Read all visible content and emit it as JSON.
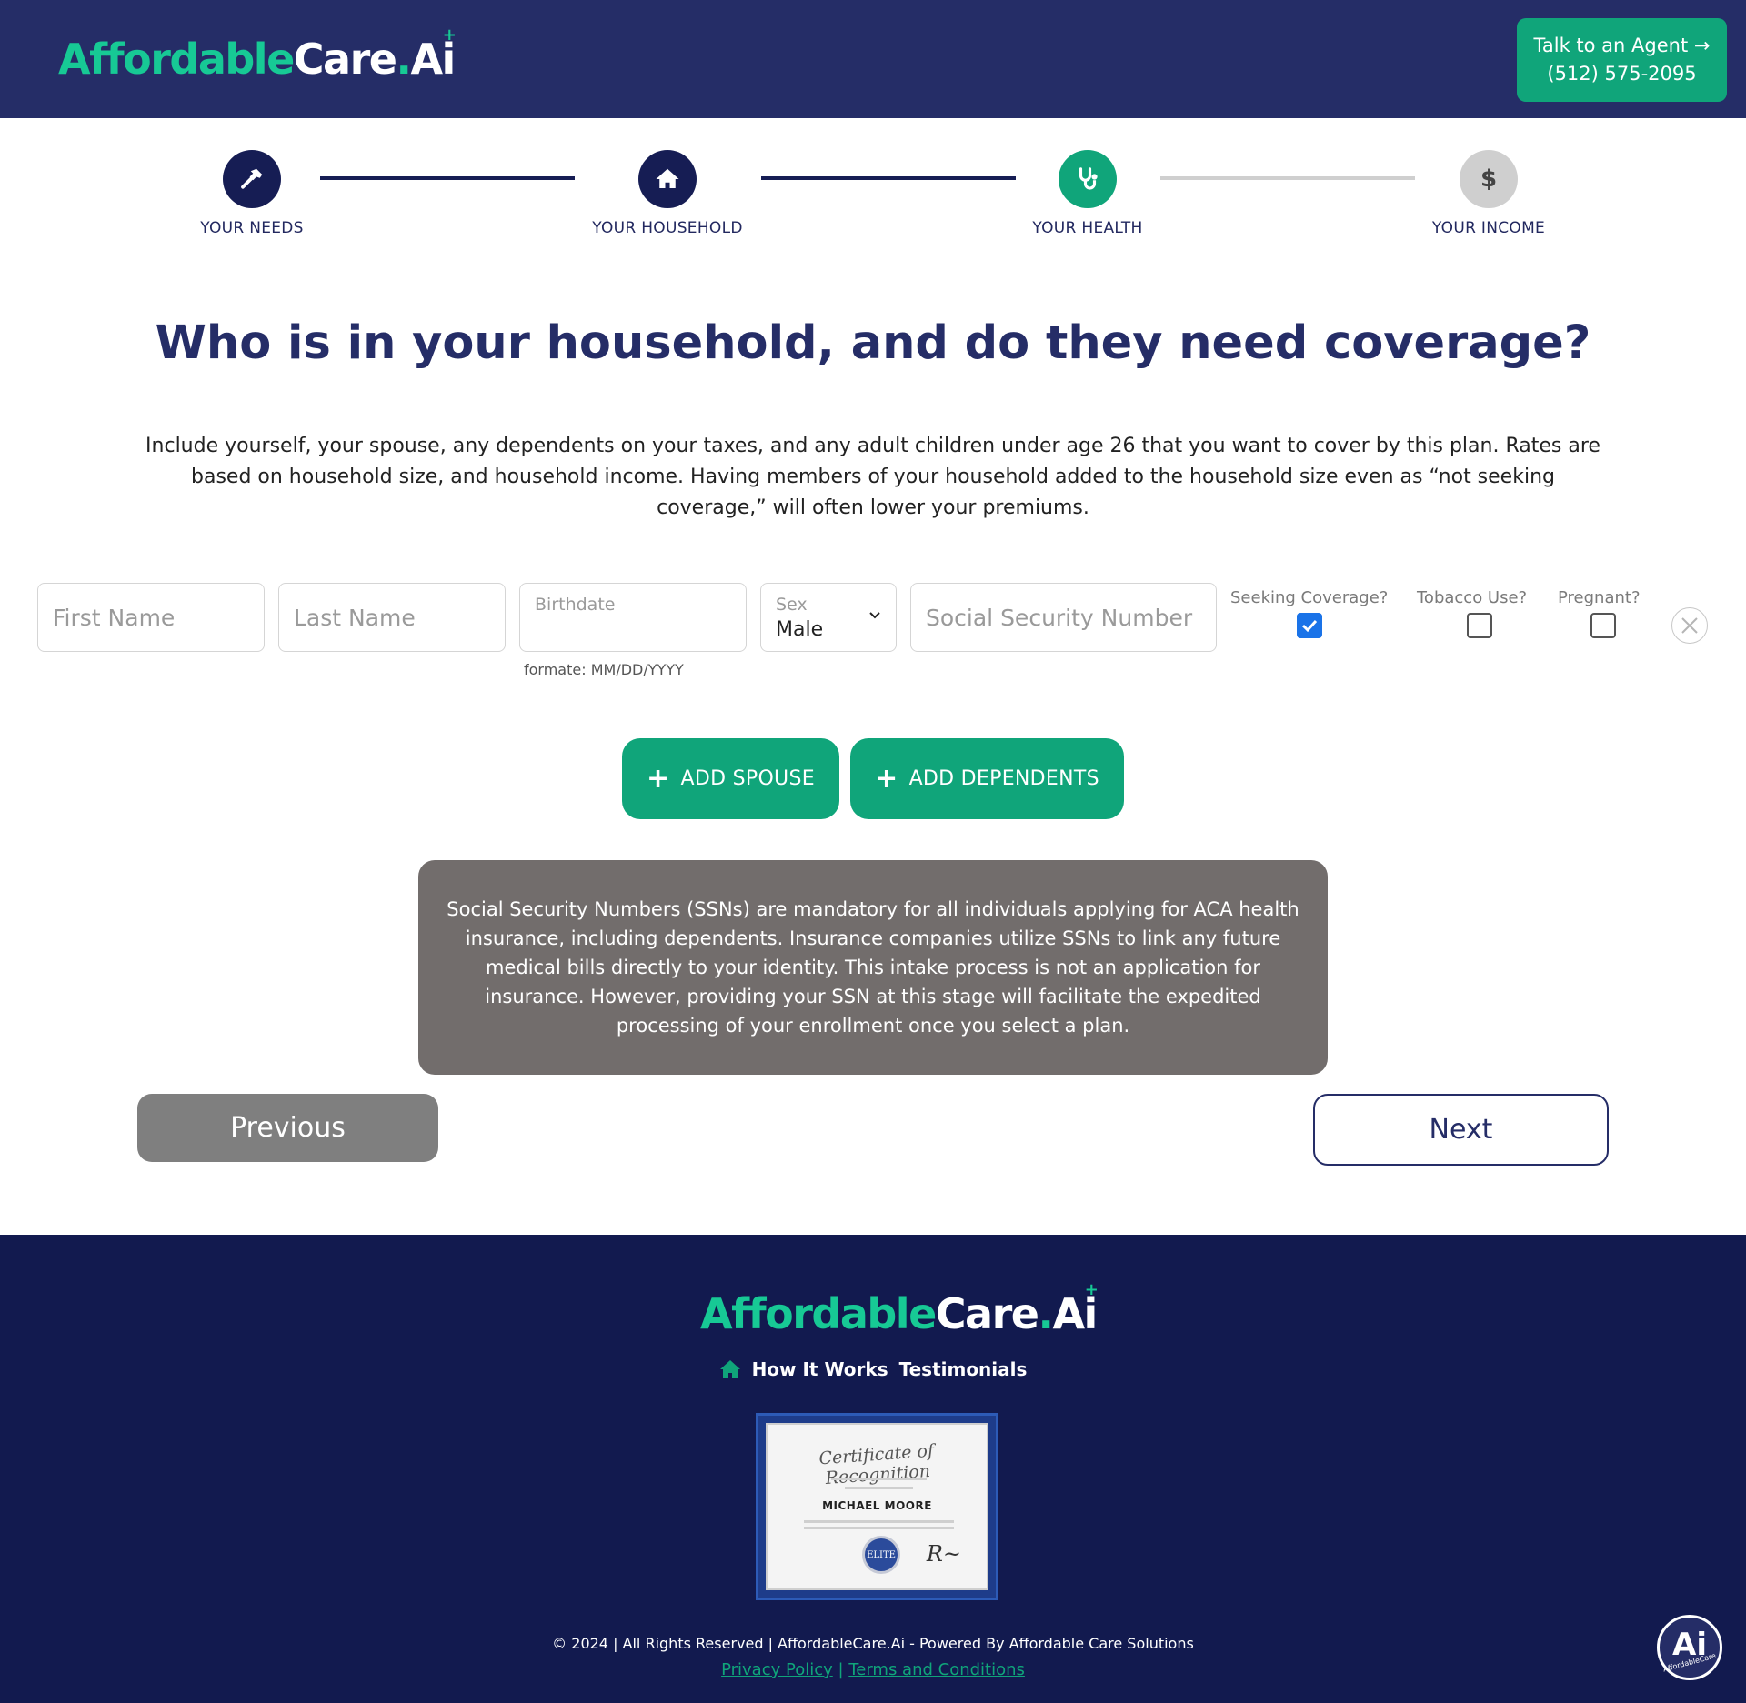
{
  "brand": {
    "logo_part1": "Affordable",
    "logo_part2": "Care",
    "logo_dot": ".",
    "logo_part3": "Ai",
    "primary_color": "#252d67",
    "accent_color": "#10a57a"
  },
  "header": {
    "agent_line1": "Talk to an Agent →",
    "agent_line2": "(512) 575-2095"
  },
  "stepper": {
    "steps": [
      {
        "label": "YOUR NEEDS",
        "icon": "hammer-icon",
        "status": "complete"
      },
      {
        "label": "YOUR HOUSEHOLD",
        "icon": "home-icon",
        "status": "complete"
      },
      {
        "label": "YOUR HEALTH",
        "icon": "stethoscope-icon",
        "status": "current"
      },
      {
        "label": "YOUR INCOME",
        "icon": "dollar-icon",
        "status": "upcoming"
      }
    ]
  },
  "main": {
    "title": "Who is in your household, and do they need coverage?",
    "intro": "Include yourself, your spouse, any dependents on your taxes, and any adult children under age 26 that you want to cover by this plan. Rates are based on household size, and household income. Having members of your household added to the household size even as “not seeking coverage,” will often lower your premiums."
  },
  "form": {
    "first_name_placeholder": "First Name",
    "last_name_placeholder": "Last Name",
    "birthdate_placeholder": "Birthdate",
    "birthdate_helper": "formate: MM/DD/YYYY",
    "sex_label": "Sex",
    "sex_value": "Male",
    "ssn_placeholder": "Social Security Number",
    "seeking_label": "Seeking Coverage?",
    "seeking_checked": true,
    "tobacco_label": "Tobacco Use?",
    "tobacco_checked": false,
    "pregnant_label": "Pregnant?",
    "pregnant_checked": false
  },
  "actions": {
    "add_spouse": "ADD SPOUSE",
    "add_dependents": "ADD DEPENDENTS",
    "previous": "Previous",
    "next": "Next"
  },
  "notice": {
    "text": "Social Security Numbers (SSNs) are mandatory for all individuals applying for ACA health insurance, including dependents. Insurance companies utilize SSNs to link any future medical bills directly to your identity. This intake process is not an application for insurance. However, providing your SSN at this stage will facilitate the expedited processing of your enrollment once you select a plan."
  },
  "footer": {
    "nav": [
      "How It Works",
      "Testimonials"
    ],
    "certificate_title": "Certificate of Recognition",
    "certificate_name": "MICHAEL MOORE",
    "certificate_seal": "ELITE",
    "copyright": "© 2024 | All Rights Reserved | AffordableCare.Ai - Powered By Affordable Care Solutions",
    "privacy": "Privacy Policy",
    "separator": "|",
    "terms": "Terms and Conditions"
  },
  "chat_badge": {
    "big": "Ai",
    "small": "AffordableCare"
  }
}
